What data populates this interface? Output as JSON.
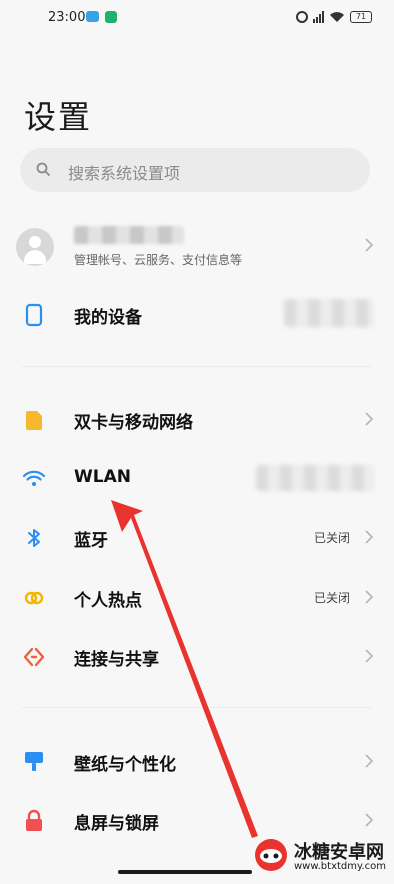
{
  "status_bar": {
    "time": "23:00",
    "battery": "71"
  },
  "header": {
    "title": "设置"
  },
  "search": {
    "placeholder": "搜索系统设置项"
  },
  "account": {
    "subtitle": "管理帐号、云服务、支付信息等"
  },
  "rows": {
    "my_device": {
      "label": "我的设备"
    },
    "sim": {
      "label": "双卡与移动网络"
    },
    "wlan": {
      "label": "WLAN"
    },
    "bluetooth": {
      "label": "蓝牙",
      "value": "已关闭"
    },
    "hotspot": {
      "label": "个人热点",
      "value": "已关闭"
    },
    "connect_share": {
      "label": "连接与共享"
    },
    "wallpaper": {
      "label": "壁纸与个性化"
    },
    "lock_screen": {
      "label": "息屏与锁屏"
    }
  },
  "watermark": {
    "title": "冰糖安卓网",
    "url": "www.btxtdmy.com"
  },
  "colors": {
    "accent_blue": "#2a8ff0",
    "sim_yellow": "#f5b82e",
    "hotspot_yellow": "#f4b400",
    "share_red": "#f06040",
    "lock_red": "#f05050",
    "arrow_red": "#e8332e"
  }
}
